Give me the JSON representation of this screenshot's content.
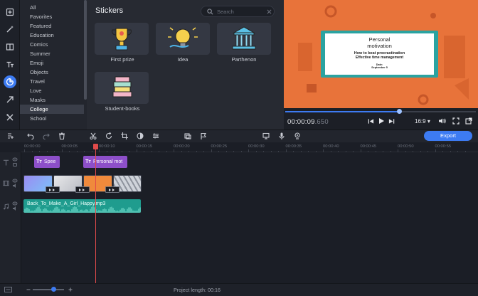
{
  "categories": [
    "All",
    "Favorites",
    "Featured",
    "Education",
    "Comics",
    "Summer",
    "Emoji",
    "Objects",
    "Travel",
    "Love",
    "Masks",
    "College",
    "School"
  ],
  "selected_category": "College",
  "stickers": {
    "title": "Stickers",
    "search_placeholder": "Search",
    "items": [
      "First prize",
      "Idea",
      "Parthenon",
      "Student-books"
    ]
  },
  "preview": {
    "slide_title_line1": "Personal",
    "slide_title_line2": "motivation",
    "slide_sub1": "How to beat procrastination",
    "slide_sub2": "Effective time management",
    "slide_date_label": "Date:",
    "slide_date": "September 5",
    "timecode_main": "00:00:09",
    "timecode_frac": ".650",
    "progress": 0.6,
    "aspect": "16:9",
    "aspect_caret": "▾"
  },
  "timeline": {
    "export_label": "Export",
    "ruler_labels": [
      "00:00:00",
      "00:00:05",
      "00:00:10",
      "00:00:15",
      "00:00:20",
      "00:00:25",
      "00:00:30",
      "00:00:35",
      "00:00:40",
      "00:00:45",
      "00:00:50",
      "00:00:55"
    ],
    "title_clips": [
      "Spee",
      "Personal mot"
    ],
    "title_icon_text": "Tт",
    "audio_clip": "Back_To_Make_A_Girl_Happy.mp3",
    "zoom": 0.68
  },
  "status": {
    "project_length_label": "Project length:",
    "project_length": "00:16"
  },
  "colors": {
    "accent": "#3d7bf2",
    "title_clip": "#8d4fc9",
    "audio_clip": "#1f9c8e",
    "preview_bg": "#e8733a",
    "playhead": "#e14b4b"
  }
}
